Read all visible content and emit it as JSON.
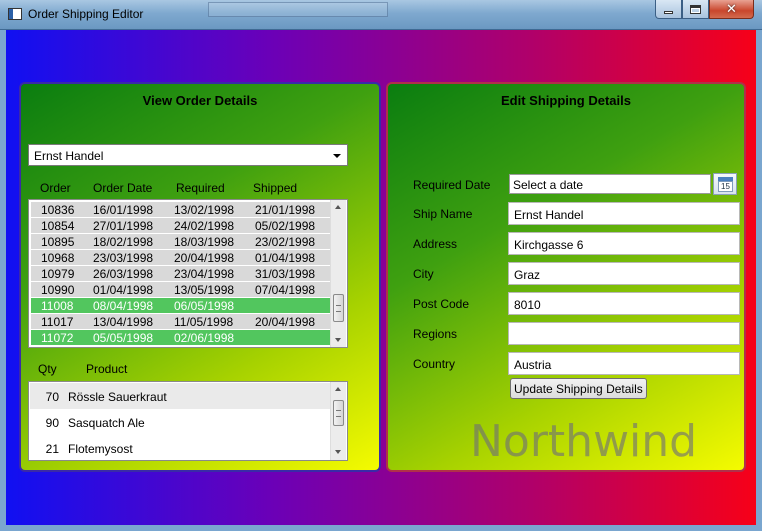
{
  "window": {
    "title": "Order Shipping Editor",
    "buttons": {
      "minimize_icon": "minimize-icon",
      "maximize_icon": "maximize-icon",
      "close_icon": "close-icon",
      "close_glyph": "✕"
    }
  },
  "left_panel": {
    "title": "View Order Details",
    "customer_combo": {
      "selected": "Ernst Handel"
    },
    "orders": {
      "columns": [
        "Order",
        "Order Date",
        "Required",
        "Shipped"
      ],
      "rows": [
        {
          "order": "10836",
          "order_date": "16/01/1998",
          "required": "13/02/1998",
          "shipped": "21/01/1998"
        },
        {
          "order": "10854",
          "order_date": "27/01/1998",
          "required": "24/02/1998",
          "shipped": "05/02/1998"
        },
        {
          "order": "10895",
          "order_date": "18/02/1998",
          "required": "18/03/1998",
          "shipped": "23/02/1998"
        },
        {
          "order": "10968",
          "order_date": "23/03/1998",
          "required": "20/04/1998",
          "shipped": "01/04/1998"
        },
        {
          "order": "10979",
          "order_date": "26/03/1998",
          "required": "23/04/1998",
          "shipped": "31/03/1998"
        },
        {
          "order": "10990",
          "order_date": "01/04/1998",
          "required": "13/05/1998",
          "shipped": "07/04/1998"
        },
        {
          "order": "11008",
          "order_date": "08/04/1998",
          "required": "06/05/1998",
          "shipped": ""
        },
        {
          "order": "11017",
          "order_date": "13/04/1998",
          "required": "11/05/1998",
          "shipped": "20/04/1998"
        },
        {
          "order": "11072",
          "order_date": "05/05/1998",
          "required": "02/06/1998",
          "shipped": ""
        }
      ]
    },
    "details": {
      "columns": [
        "Qty",
        "Product"
      ],
      "rows": [
        {
          "qty": "70",
          "product": "Rössle Sauerkraut"
        },
        {
          "qty": "90",
          "product": "Sasquatch Ale"
        },
        {
          "qty": "21",
          "product": "Flotemysost"
        }
      ]
    }
  },
  "right_panel": {
    "title": "Edit Shipping Details",
    "labels": {
      "required_date": "Required Date",
      "ship_name": "Ship Name",
      "address": "Address",
      "city": "City",
      "post_code": "Post Code",
      "regions": "Regions",
      "country": "Country"
    },
    "values": {
      "required_date_placeholder": "Select a date",
      "calendar_day": "15",
      "ship_name": "Ernst Handel",
      "address": "Kirchgasse 6",
      "city": "Graz",
      "post_code": "8010",
      "regions": "",
      "country": "Austria"
    },
    "update_button": "Update Shipping Details",
    "watermark": "Northwind"
  },
  "colors": {
    "selected_row": "#52c65e",
    "row_background": "#d9d9d9",
    "panel_gradient_start": "#0a7d10",
    "panel_gradient_end": "#f5fb00",
    "background_left": "#1010f2",
    "background_right": "#f70018"
  }
}
